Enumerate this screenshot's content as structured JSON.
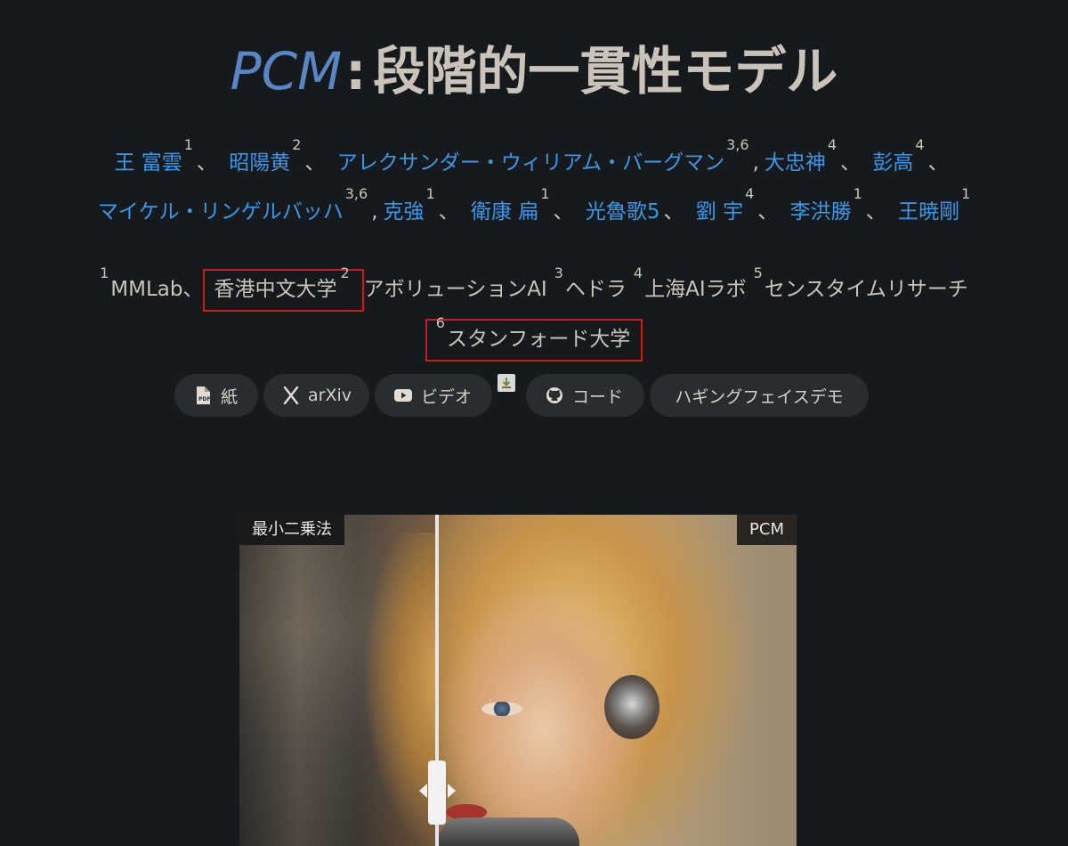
{
  "title": {
    "brand": "PCM",
    "colon": ":",
    "text": "段階的一貫性モデル"
  },
  "authors": {
    "row1": [
      {
        "name": "王 富雲",
        "sup": "1",
        "sep": "、"
      },
      {
        "name": "昭陽黄",
        "sup": "2",
        "sep": "、"
      },
      {
        "name": "アレクサンダー・ウィリアム・バーグマン",
        "sup": "3,6",
        "sep": ","
      },
      {
        "name": "大忠神",
        "sup": "4",
        "sep": "、"
      },
      {
        "name": "彭高",
        "sup": "4",
        "sep": "、"
      }
    ],
    "row2": [
      {
        "name": "マイケル・リンゲルバッハ",
        "sup": "3,6",
        "sep": ","
      },
      {
        "name": "克強",
        "sup": "1",
        "sep": "、"
      },
      {
        "name": "衛康 扁",
        "sup": "1",
        "sep": "、"
      },
      {
        "name": "光魯歌5",
        "sup": "",
        "sep": "、"
      },
      {
        "name": "劉 宇",
        "sup": "4",
        "sep": "、"
      },
      {
        "name": "李洪勝",
        "sup": "1",
        "sep": "、"
      },
      {
        "name": "王暁剛",
        "sup": "1",
        "sep": ""
      }
    ]
  },
  "affiliations": {
    "row1": [
      {
        "sup": "1",
        "name": "MMLab、",
        "boxed": false
      },
      {
        "sup": "",
        "name": "香港中文大学",
        "boxed": true,
        "trail_sup": "2"
      },
      {
        "sup": "",
        "name": "アボリューションAI",
        "boxed": false
      },
      {
        "sup": "3",
        "name": "ヘドラ",
        "boxed": false
      },
      {
        "sup": "4",
        "name": "上海AIラボ",
        "boxed": false
      },
      {
        "sup": "5",
        "name": "センスタイムリサーチ",
        "boxed": false
      }
    ],
    "row2": [
      {
        "sup": "6",
        "name": "スタンフォード大学",
        "boxed": true
      }
    ]
  },
  "buttons": {
    "paper": "紙",
    "arxiv": "arXiv",
    "video": "ビデオ",
    "code": "コード",
    "demo": "ハギングフェイスデモ"
  },
  "compare": {
    "left_label": "最小二乗法",
    "right_label": "PCM",
    "slider_fraction": 0.355
  },
  "colors": {
    "background": "#171a1c",
    "brand": "#5b86c5",
    "link": "#3d97e8",
    "highlight_box": "#d11b1b",
    "button_bg": "#292d30"
  }
}
